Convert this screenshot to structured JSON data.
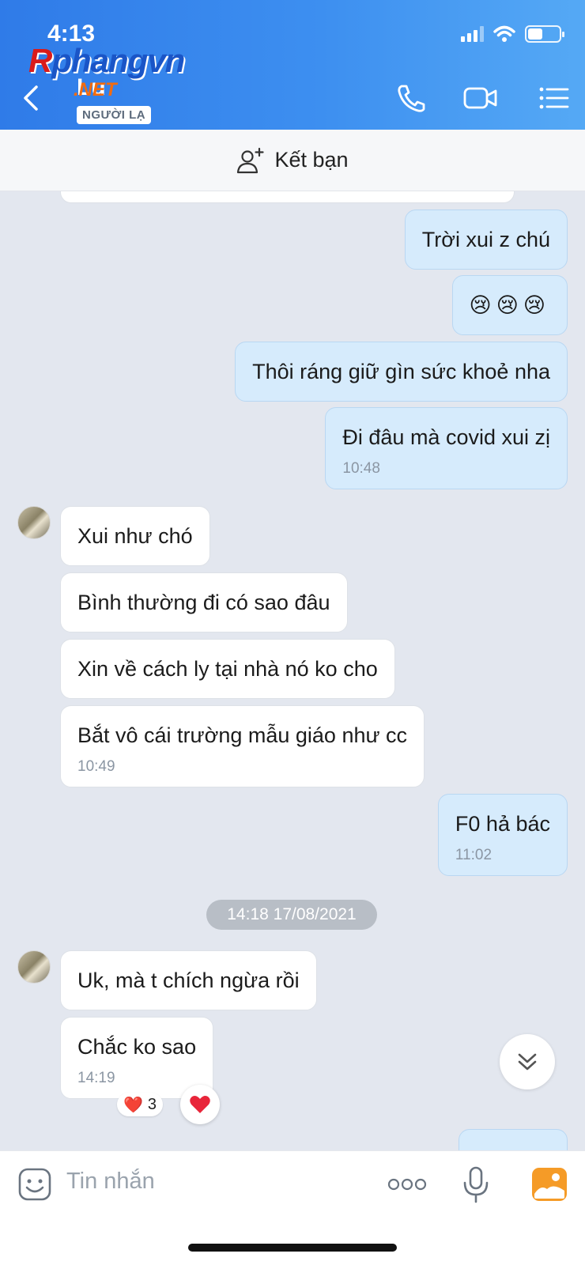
{
  "status_bar": {
    "time": "4:13"
  },
  "watermark": {
    "brand_r": "R",
    "brand_rest": "phangvn",
    "brand_net": ".NET"
  },
  "header": {
    "contact_name": "Lu",
    "badge": "NGƯỜI LẠ"
  },
  "add_friend": {
    "label": "Kết bạn"
  },
  "messages": [
    {
      "dir": "out",
      "text": "Trời xui z chú"
    },
    {
      "dir": "out",
      "text": "😢😢😢"
    },
    {
      "dir": "out",
      "text": "Thôi ráng giữ gìn sức khoẻ nha"
    },
    {
      "dir": "out",
      "text": "Đi đâu mà covid xui zị",
      "time": "10:48"
    },
    {
      "dir": "in",
      "text": "Xui như chó"
    },
    {
      "dir": "in",
      "text": "Bình thường đi có sao đâu"
    },
    {
      "dir": "in",
      "text": "Xin về cách ly tại nhà nó ko cho"
    },
    {
      "dir": "in",
      "text": "Bắt vô cái trường mẫu giáo như cc",
      "time": "10:49"
    },
    {
      "dir": "out",
      "text": "F0 hả bác",
      "time": "11:02"
    },
    {
      "dir": "in",
      "text": "Uk, mà t chích ngừa rồi"
    },
    {
      "dir": "in",
      "text": "Chắc ko sao",
      "time": "14:19"
    }
  ],
  "date_separator": "14:18 17/08/2021",
  "reaction": {
    "emoji": "❤️",
    "count": "3"
  },
  "input": {
    "placeholder": "Tin nhắn"
  },
  "colors": {
    "header_blue": "#2f7be8",
    "bubble_out": "#d6ebfc",
    "bubble_in": "#ffffff",
    "chat_bg": "#e3e7ef"
  }
}
